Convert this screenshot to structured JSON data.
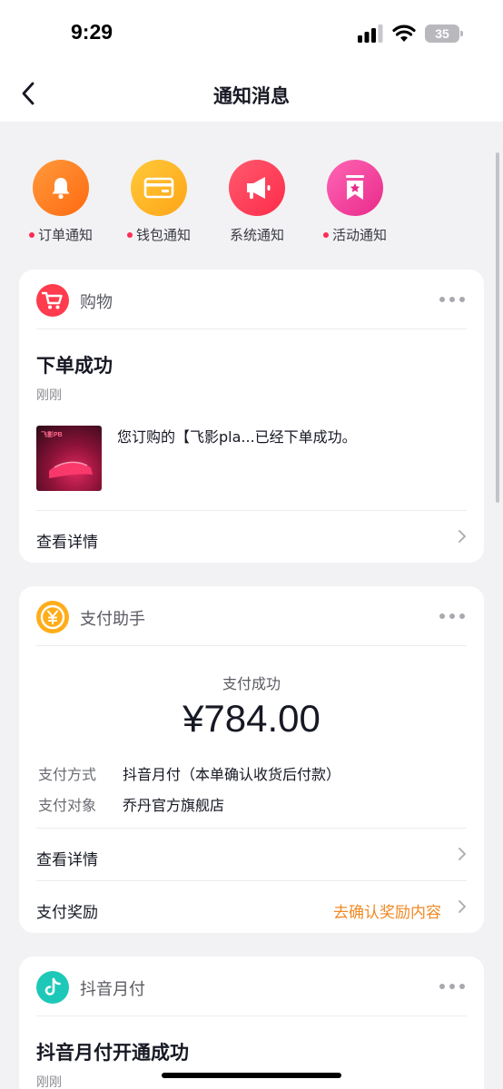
{
  "status": {
    "time": "9:29",
    "battery": "35"
  },
  "nav": {
    "title": "通知消息"
  },
  "categories": [
    {
      "label": "订单通知",
      "icon": "bell-icon",
      "color": "#ff7a1f",
      "dot": true
    },
    {
      "label": "钱包通知",
      "icon": "card-icon",
      "color": "#ffb01f",
      "dot": true
    },
    {
      "label": "系统通知",
      "icon": "megaphone-icon",
      "color": "#fe3a55",
      "dot": false
    },
    {
      "label": "活动通知",
      "icon": "bookmark-star-icon",
      "color": "#f43a9a",
      "dot": true
    }
  ],
  "shopping_card": {
    "source": "购物",
    "title": "下单成功",
    "time": "刚刚",
    "message": "您订购的【飞影pla...已经下单成功。",
    "thumbnail_text": "飞影PB",
    "detail_link": "查看详情"
  },
  "payment_card": {
    "source": "支付助手",
    "status": "支付成功",
    "amount": "¥784.00",
    "method_label": "支付方式",
    "method_value": "抖音月付（本单确认收货后付款）",
    "target_label": "支付对象",
    "target_value": "乔丹官方旗舰店",
    "detail_link": "查看详情",
    "reward_label": "支付奖励",
    "reward_action": "去确认奖励内容"
  },
  "monthly_card": {
    "source": "抖音月付",
    "title": "抖音月付开通成功",
    "time": "刚刚"
  },
  "colors": {
    "accent_red": "#fe2c55",
    "reward_orange": "#f08a24",
    "background": "#f2f2f4"
  }
}
